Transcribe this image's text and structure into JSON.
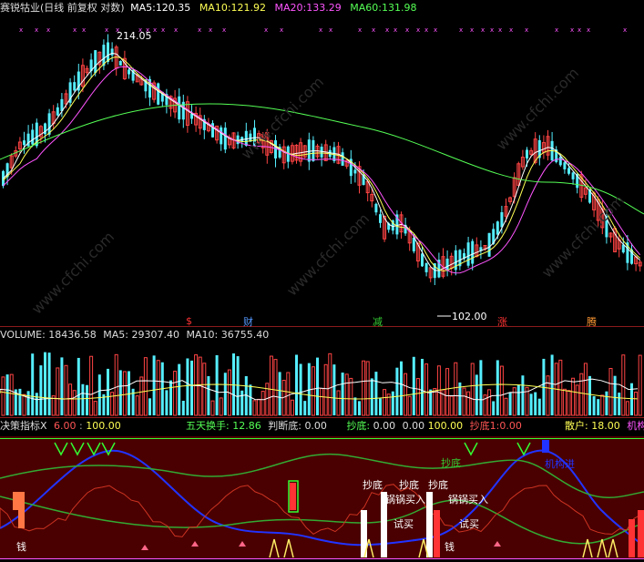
{
  "main_header": {
    "name": "赛锐牯业(日线 前复权 对数)",
    "items": [
      {
        "label": "MA5:",
        "value": "120.35",
        "color": "#ffffff"
      },
      {
        "label": "MA10:",
        "value": "121.92",
        "color": "#ffff55"
      },
      {
        "label": "MA20:",
        "value": "133.29",
        "color": "#ff55ff"
      },
      {
        "label": "MA60:",
        "value": "131.98",
        "color": "#55ff55"
      }
    ]
  },
  "price_labels": {
    "high": "214.05",
    "low": "102.00"
  },
  "event_markers": [
    {
      "text": "$",
      "color": "#ff3333"
    },
    {
      "text": "财",
      "color": "#5599ff"
    },
    {
      "text": "减",
      "color": "#33cc33"
    },
    {
      "text": "涨",
      "color": "#ff3333"
    },
    {
      "text": "腾",
      "color": "#ff9933"
    }
  ],
  "volume_header": {
    "label": "VOLUME:",
    "value": "18436.58",
    "ma5_label": "MA5:",
    "ma5": "29307.40",
    "ma10_label": "MA10:",
    "ma10": "36755.40"
  },
  "indicator_header": {
    "name": "决策指标X",
    "val_a": "6.00",
    "val_b": "100.00",
    "five_day_label": "五天换手:",
    "five_day": "12.86",
    "judge_label": "判断底:",
    "judge": "0.00",
    "chaodi_label": "抄底:",
    "chaodi": "0.00",
    "val_c": "0.00",
    "val_d": "100.00",
    "chaodi2": "抄底1:0.00",
    "sanhu_label": "散户:",
    "sanhu": "18.00",
    "jigou": "机构"
  },
  "indicator_labels": {
    "chaodi": "抄底",
    "guoguo": "锅锅买入",
    "shishi": "试买",
    "jigou_jincheng": "机构进",
    "qian": "钱",
    "qian2": "钱"
  },
  "watermarks": [
    "www.cfchi.com",
    "www.cfchi.com",
    "www.cfchi.com",
    "www.cfchi.com",
    "www.cfchi.com"
  ],
  "colors": {
    "up": "#ff4444",
    "down": "#55eeff",
    "ma5": "#ffffff",
    "ma10": "#ffff55",
    "ma20": "#ff55ff",
    "ma60": "#55ff55",
    "indicator_bg": "#5a0000",
    "blue_line": "#2233ff",
    "green_line": "#33aa33"
  }
}
